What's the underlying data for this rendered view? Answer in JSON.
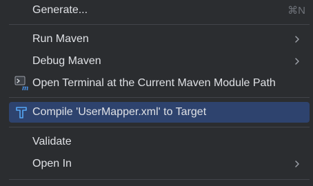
{
  "menu": {
    "generate": {
      "label": "Generate...",
      "shortcut": "⌘N"
    },
    "run_maven": {
      "label": "Run Maven"
    },
    "debug_maven": {
      "label": "Debug Maven"
    },
    "open_terminal": {
      "label": "Open Terminal at the Current Maven Module Path",
      "icon": "maven-terminal-icon"
    },
    "compile": {
      "label": "Compile 'UserMapper.xml' to Target",
      "icon": "compile-hammer-icon"
    },
    "validate": {
      "label": "Validate"
    },
    "open_in": {
      "label": "Open In"
    }
  },
  "colors": {
    "background": "#2b2d30",
    "selection": "#2e436e",
    "text": "#dfe1e5",
    "shortcut": "#6f737a",
    "separator": "#43454a"
  }
}
